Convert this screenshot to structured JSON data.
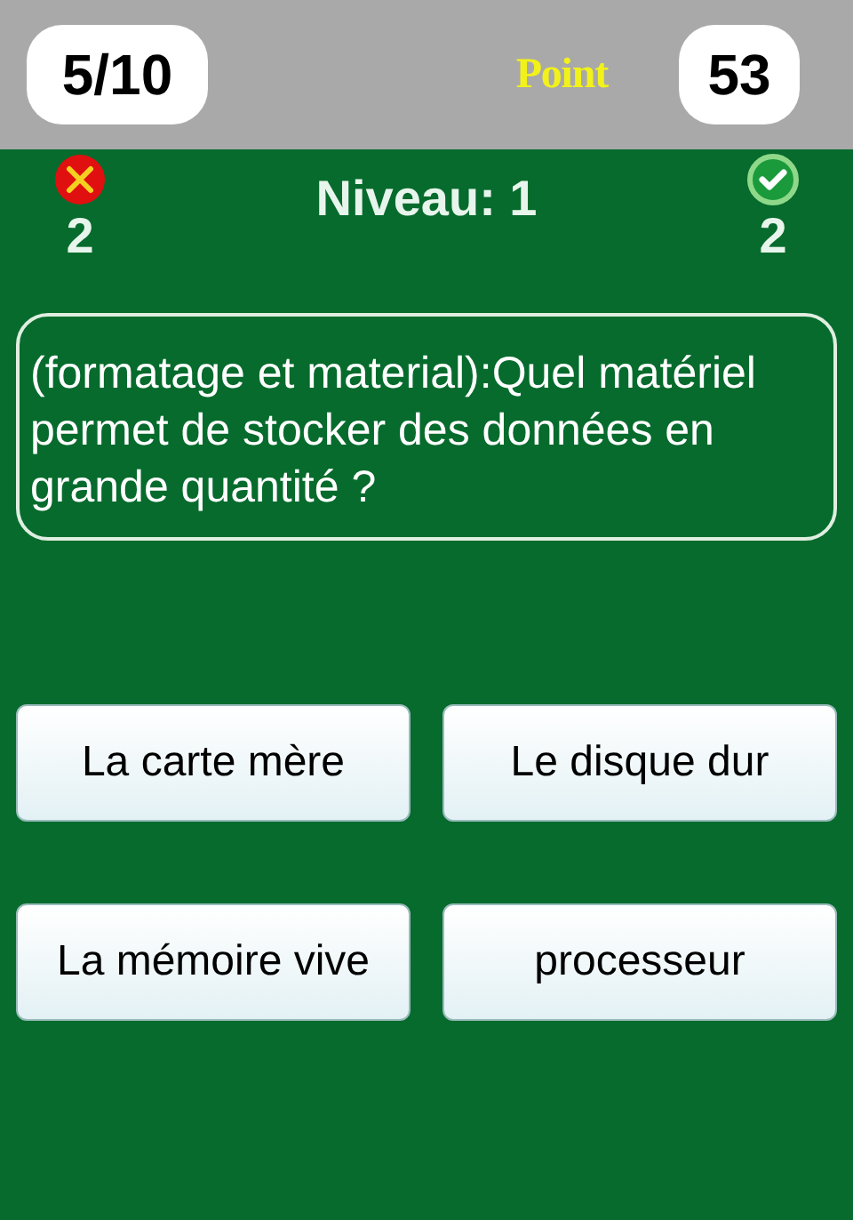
{
  "header": {
    "progress": "5/10",
    "points_label": "Point",
    "points": "53"
  },
  "status": {
    "wrong_count": "2",
    "level": "Niveau: 1",
    "right_count": "2"
  },
  "question": "(formatage et material):Quel matériel permet de stocker des données en grande quantité ?",
  "answers": [
    "La carte mère",
    "Le disque dur",
    "La mémoire vive",
    "processeur"
  ]
}
